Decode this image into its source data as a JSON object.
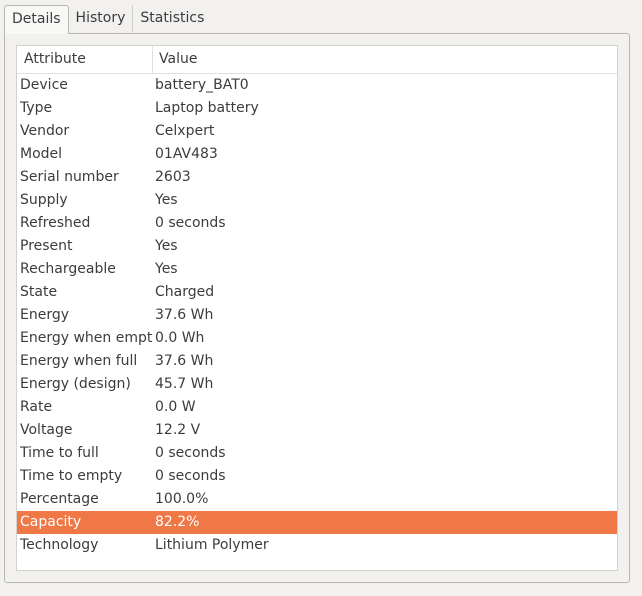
{
  "tabs": [
    {
      "label": "Details",
      "active": true
    },
    {
      "label": "History",
      "active": false
    },
    {
      "label": "Statistics",
      "active": false
    }
  ],
  "table": {
    "headers": {
      "attribute": "Attribute",
      "value": "Value"
    },
    "rows": [
      {
        "attribute": "Device",
        "value": "battery_BAT0"
      },
      {
        "attribute": "Type",
        "value": "Laptop battery"
      },
      {
        "attribute": "Vendor",
        "value": "Celxpert"
      },
      {
        "attribute": "Model",
        "value": "01AV483"
      },
      {
        "attribute": "Serial number",
        "value": "2603"
      },
      {
        "attribute": "Supply",
        "value": "Yes"
      },
      {
        "attribute": "Refreshed",
        "value": "0 seconds"
      },
      {
        "attribute": "Present",
        "value": "Yes"
      },
      {
        "attribute": "Rechargeable",
        "value": "Yes"
      },
      {
        "attribute": "State",
        "value": "Charged"
      },
      {
        "attribute": "Energy",
        "value": "37.6 Wh"
      },
      {
        "attribute": "Energy when empty",
        "value": "0.0 Wh"
      },
      {
        "attribute": "Energy when full",
        "value": "37.6 Wh"
      },
      {
        "attribute": "Energy (design)",
        "value": "45.7 Wh"
      },
      {
        "attribute": "Rate",
        "value": "0.0 W"
      },
      {
        "attribute": "Voltage",
        "value": "12.2 V"
      },
      {
        "attribute": "Time to full",
        "value": "0 seconds"
      },
      {
        "attribute": "Time to empty",
        "value": "0 seconds"
      },
      {
        "attribute": "Percentage",
        "value": "100.0%"
      },
      {
        "attribute": "Capacity",
        "value": "82.2%",
        "selected": true
      },
      {
        "attribute": "Technology",
        "value": "Lithium Polymer"
      }
    ]
  },
  "colors": {
    "selection": "#f07746",
    "background": "#f2f1f0"
  }
}
